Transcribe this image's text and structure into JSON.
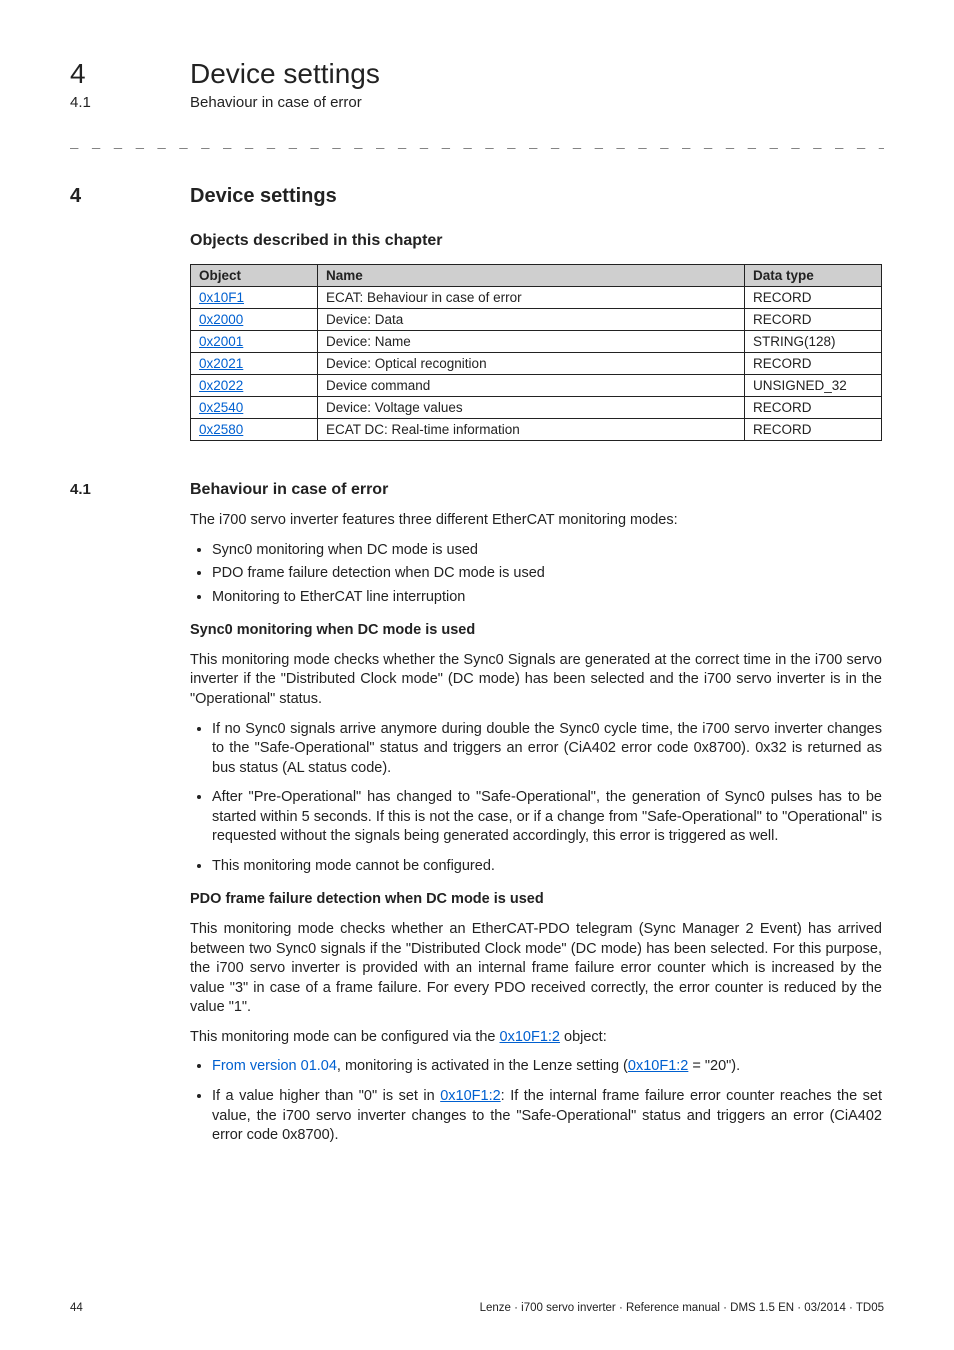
{
  "header": {
    "chapter_num": "4",
    "chapter_title": "Device settings",
    "section_num": "4.1",
    "section_title": "Behaviour in case of error"
  },
  "dash_line": "_ _ _ _ _ _ _ _ _ _ _ _ _ _ _ _ _ _ _ _ _ _ _ _ _ _ _ _ _ _ _ _ _ _ _ _ _ _ _ _ _ _ _ _ _ _ _ _ _ _ _ _ _ _ _ _ _ _ _ _ _ _ _ _",
  "main_heading": {
    "num": "4",
    "title": "Device settings"
  },
  "objects_heading": "Objects described in this chapter",
  "table": {
    "headers": {
      "object": "Object",
      "name": "Name",
      "datatype": "Data type"
    },
    "rows": [
      {
        "object": "0x10F1",
        "name": "ECAT: Behaviour in case of error",
        "datatype": "RECORD"
      },
      {
        "object": "0x2000",
        "name": "Device: Data",
        "datatype": "RECORD"
      },
      {
        "object": "0x2001",
        "name": "Device: Name",
        "datatype": "STRING(128)"
      },
      {
        "object": "0x2021",
        "name": "Device: Optical recognition",
        "datatype": "RECORD"
      },
      {
        "object": "0x2022",
        "name": "Device command",
        "datatype": "UNSIGNED_32"
      },
      {
        "object": "0x2540",
        "name": "Device: Voltage values",
        "datatype": "RECORD"
      },
      {
        "object": "0x2580",
        "name": "ECAT DC: Real-time information",
        "datatype": "RECORD"
      }
    ]
  },
  "section": {
    "num": "4.1",
    "title": "Behaviour in case of error",
    "intro": "The i700 servo inverter features three different EtherCAT monitoring modes:",
    "modes": [
      "Sync0 monitoring when DC mode is used",
      "PDO frame failure detection when DC mode is used",
      "Monitoring to EtherCAT line interruption"
    ],
    "sync0": {
      "heading": "Sync0 monitoring when DC mode is used",
      "para": "This monitoring mode checks whether the Sync0 Signals are generated at the correct time in the i700 servo inverter if the \"Distributed Clock mode\" (DC mode) has been selected and the i700 servo inverter is in the \"Operational\" status.",
      "bullets": [
        "If no Sync0 signals arrive anymore during double the Sync0 cycle time, the i700 servo inverter changes to the \"Safe-Operational\" status and triggers an error (CiA402 error code 0x8700). 0x32 is returned as bus status (AL status code).",
        "After \"Pre-Operational\" has changed to \"Safe-Operational\", the generation of Sync0 pulses has to be started within 5 seconds. If this is not the case, or if a change from \"Safe-Operational\" to \"Operational\" is requested without the signals being generated accordingly, this error is triggered as well.",
        "This monitoring mode cannot be configured."
      ]
    },
    "pdo": {
      "heading": "PDO frame failure detection when DC mode is used",
      "para": "This monitoring mode checks whether an EtherCAT-PDO telegram (Sync Manager 2 Event) has arrived between two Sync0 signals if the \"Distributed Clock mode\" (DC mode) has been selected. For this purpose, the i700 servo inverter is provided with an internal frame failure error counter which is increased by the value \"3\" in case of a frame failure. For every PDO received correctly, the error counter is reduced by the value \"1\".",
      "conf_prefix": "This monitoring mode can be configured via the ",
      "conf_link": "0x10F1:2",
      "conf_suffix": " object:",
      "b1_prefix": "From version 01.04",
      "b1_mid": ", monitoring is activated in the Lenze setting (",
      "b1_link": "0x10F1:2",
      "b1_suffix": " = \"20\").",
      "b2_prefix": "If a value higher than \"0\" is set in ",
      "b2_link": "0x10F1:2",
      "b2_suffix": ": If the internal frame failure error counter reaches the set value, the i700 servo inverter changes to the \"Safe-Operational\" status and triggers an error (CiA402 error code 0x8700)."
    }
  },
  "footer": {
    "page": "44",
    "info": "Lenze · i700 servo inverter · Reference manual · DMS 1.5 EN · 03/2014 · TD05"
  }
}
